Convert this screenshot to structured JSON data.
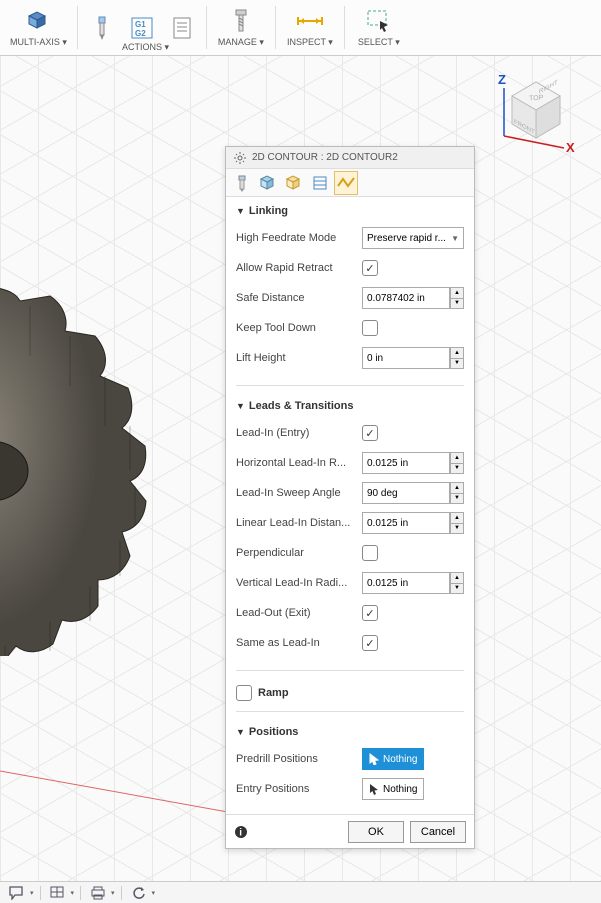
{
  "toolbar": {
    "items": [
      {
        "label": "MULTI-AXIS",
        "icon": "multi-axis"
      },
      {
        "label": "ACTIONS",
        "icon": "drill"
      },
      {
        "label": "",
        "icon": "g1g2"
      },
      {
        "label": "",
        "icon": "notes"
      },
      {
        "label": "MANAGE",
        "icon": "bolt"
      },
      {
        "label": "INSPECT",
        "icon": "measure"
      },
      {
        "label": "SELECT",
        "icon": "select"
      }
    ]
  },
  "viewcube": {
    "axes": [
      "X",
      "Z"
    ],
    "faces": {
      "top": "TOP",
      "front": "FRONT",
      "right": "RIGHT"
    }
  },
  "panel": {
    "title": "2D CONTOUR : 2D CONTOUR2",
    "tabs": [
      "tool-tab",
      "geometry-tab",
      "heights-tab",
      "passes-tab",
      "linking-tab"
    ],
    "active_tab": 4,
    "sections": {
      "linking": {
        "title": "Linking",
        "high_feedrate_mode": {
          "label": "High Feedrate Mode",
          "value": "Preserve rapid r..."
        },
        "allow_rapid_retract": {
          "label": "Allow Rapid Retract",
          "checked": true
        },
        "safe_distance": {
          "label": "Safe Distance",
          "value": "0.0787402 in"
        },
        "keep_tool_down": {
          "label": "Keep Tool Down",
          "checked": false
        },
        "lift_height": {
          "label": "Lift Height",
          "value": "0 in"
        }
      },
      "leads": {
        "title": "Leads & Transitions",
        "lead_in_entry": {
          "label": "Lead-In (Entry)",
          "checked": true
        },
        "horizontal_lead_in_radius": {
          "label": "Horizontal Lead-In R...",
          "value": "0.0125 in"
        },
        "lead_in_sweep_angle": {
          "label": "Lead-In Sweep Angle",
          "value": "90 deg"
        },
        "linear_lead_in_distance": {
          "label": "Linear Lead-In Distan...",
          "value": "0.0125 in"
        },
        "perpendicular": {
          "label": "Perpendicular",
          "checked": false
        },
        "vertical_lead_in_radius": {
          "label": "Vertical Lead-In Radi...",
          "value": "0.0125 in"
        },
        "lead_out_exit": {
          "label": "Lead-Out (Exit)",
          "checked": true
        },
        "same_as_lead_in": {
          "label": "Same as Lead-In",
          "checked": true
        }
      },
      "ramp": {
        "title": "Ramp",
        "checked": false
      },
      "positions": {
        "title": "Positions",
        "predrill": {
          "label": "Predrill Positions",
          "value": "Nothing",
          "active": true
        },
        "entry": {
          "label": "Entry Positions",
          "value": "Nothing",
          "active": false
        }
      }
    },
    "footer": {
      "ok": "OK",
      "cancel": "Cancel"
    }
  }
}
